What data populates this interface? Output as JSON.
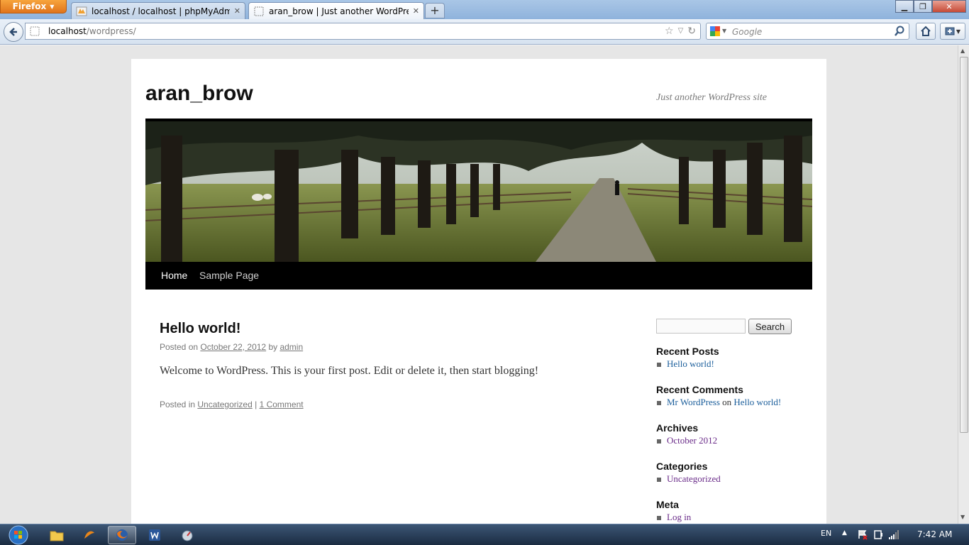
{
  "browser": {
    "app_button": "Firefox",
    "tabs": [
      {
        "title": "localhost / localhost | phpMyAdmin ...",
        "active": false
      },
      {
        "title": "aran_brow | Just another WordPress si...",
        "active": true
      }
    ],
    "newtab_label": "+",
    "url_host": "localhost",
    "url_path": "/wordpress/",
    "search_placeholder": "Google"
  },
  "site": {
    "title": "aran_brow",
    "description": "Just another WordPress site",
    "nav": [
      "Home",
      "Sample Page"
    ]
  },
  "post": {
    "title": "Hello world!",
    "meta_prefix": "Posted on ",
    "date": "October 22, 2012",
    "meta_by": " by ",
    "author": "admin",
    "content": "Welcome to WordPress. This is your first post. Edit or delete it, then start blogging!",
    "posted_in": "Posted in ",
    "category": "Uncategorized",
    "separator": " | ",
    "comments": "1 Comment"
  },
  "sidebar": {
    "search_button": "Search",
    "recent_posts": {
      "title": "Recent Posts",
      "items": [
        "Hello world!"
      ]
    },
    "recent_comments": {
      "title": "Recent Comments",
      "author": "Mr WordPress",
      "on": " on ",
      "post": "Hello world!"
    },
    "archives": {
      "title": "Archives",
      "items": [
        "October 2012"
      ]
    },
    "categories": {
      "title": "Categories",
      "items": [
        "Uncategorized"
      ]
    },
    "meta": {
      "title": "Meta",
      "items": [
        "Log in"
      ]
    }
  },
  "taskbar": {
    "language": "EN",
    "time": "7:42 AM"
  },
  "colors": {
    "link": "#1b5e9b",
    "visited": "#6a2c89",
    "nav_bg": "#000000",
    "firefox_orange": "#e0741b"
  }
}
